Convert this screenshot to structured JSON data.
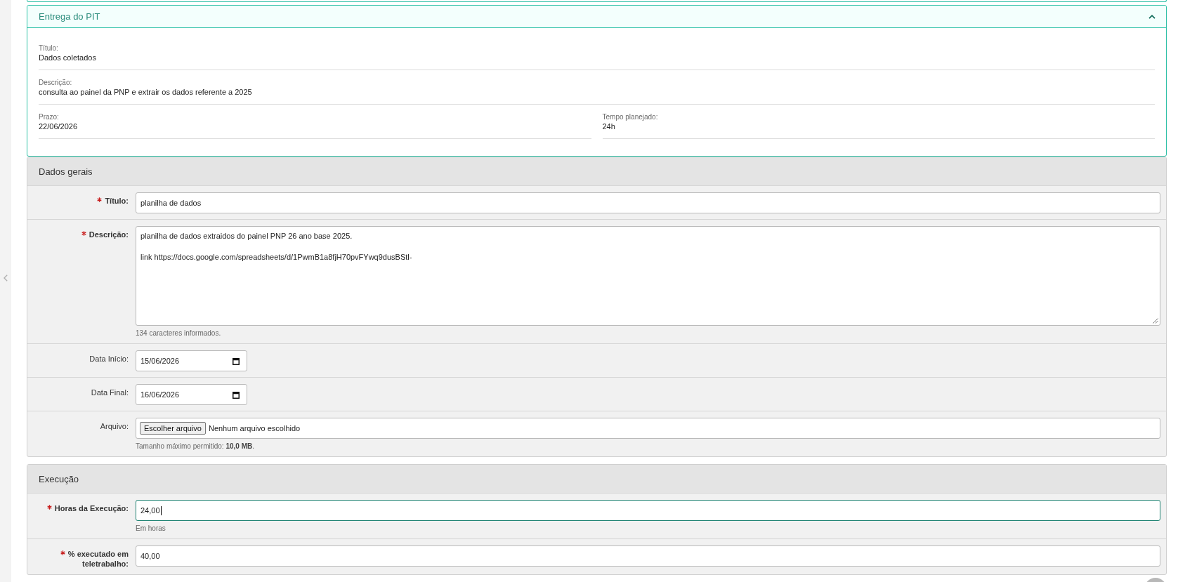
{
  "delivery_panel": {
    "title": "Entrega do PIT",
    "expanded": true,
    "rows": [
      [
        {
          "label": "Título:",
          "value": "Dados coletados"
        }
      ],
      [
        {
          "label": "Descrição:",
          "value": "consulta ao painel da PNP e extrair os dados referente a 2025"
        }
      ],
      [
        {
          "label": "Prazo:",
          "value": "22/06/2026"
        },
        {
          "label": "Tempo planejado:",
          "value": "24h"
        }
      ]
    ]
  },
  "sections": [
    {
      "title": "Dados gerais",
      "fields": [
        {
          "kind": "text",
          "label": "Título:",
          "required": true,
          "focused": false,
          "value": "planilha de dados"
        },
        {
          "kind": "textarea",
          "label": "Descrição:",
          "required": true,
          "focused": false,
          "value": "planilha de dados extraidos do painel PNP 26 ano base 2025.\n\nlink https://docs.google.com/spreadsheets/d/1PwmB1a8fjH70pvFYwq9dusBStl-",
          "help": "134 caracteres informados."
        },
        {
          "kind": "date",
          "label": "Data Início:",
          "required": false,
          "focused": false,
          "value": "15/06/2026"
        },
        {
          "kind": "date",
          "label": "Data Final:",
          "required": false,
          "focused": false,
          "value": "16/06/2026"
        },
        {
          "kind": "file",
          "label": "Arquivo:",
          "required": false,
          "focused": false,
          "button": "Escolher arquivo",
          "status": "Nenhum arquivo escolhido",
          "help": "Tamanho máximo permitido: **10,0 MB**."
        }
      ]
    },
    {
      "title": "Execução",
      "fields": [
        {
          "kind": "text",
          "label": "Horas da Execução:",
          "required": true,
          "focused": true,
          "value": "24,00",
          "help": "Em horas"
        },
        {
          "kind": "text",
          "label": "% executado em teletrabalho:",
          "required": true,
          "focused": false,
          "value": "40,00"
        }
      ]
    }
  ]
}
